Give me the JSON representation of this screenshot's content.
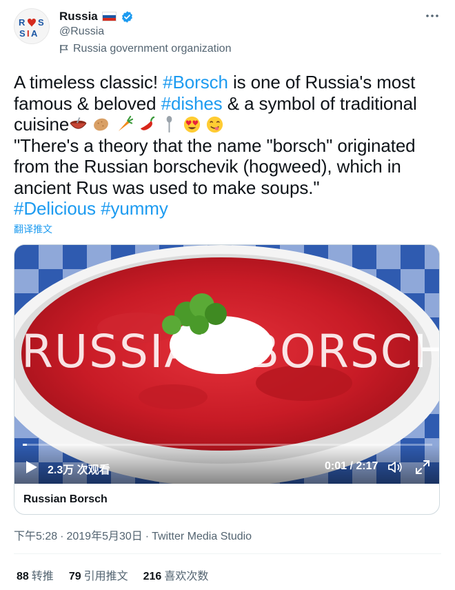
{
  "author": {
    "display_name": "Russia",
    "handle": "@Russia",
    "label": "Russia government organization",
    "avatar_text_top": "R S",
    "avatar_text_bottom": "SIA",
    "flag_colors": [
      "#ffffff",
      "#1c57a5",
      "#d52b1e"
    ],
    "verified_color": "#1d9bf0"
  },
  "tweet": {
    "line1_a": "A timeless classic! ",
    "line1_tag": "#Borsch",
    "line1_b": " is one of Russia's most",
    "line2_a": "famous & beloved ",
    "line2_tag": "#dishes",
    "line2_b": " & a symbol of traditional",
    "line3": "cuisine",
    "emojis": [
      "soup-bowl",
      "potato",
      "carrot",
      "hot-pepper",
      "spoon",
      "heart-eyes-face",
      "yum-face"
    ],
    "quote1": "\"There's a theory that the name \"borsch\" originated",
    "quote2": "from the Russian borschevik (hogweed), which in",
    "quote3": "ancient Rus was used to make soups.\"",
    "tag_a": "#Delicious",
    "tag_b": "#yummy",
    "translate": "翻译推文"
  },
  "media": {
    "overlay_title": "RUSSIAN BORSCH",
    "views": "2.3万 次观看",
    "time": "0:01 / 2:17",
    "card_title": "Russian Borsch",
    "progress": 0.007
  },
  "meta": {
    "time": "下午5:28",
    "date": "2019年5月30日",
    "source": "Twitter Media Studio"
  },
  "stats": [
    {
      "count": "88",
      "label": "转推"
    },
    {
      "count": "79",
      "label": "引用推文"
    },
    {
      "count": "216",
      "label": "喜欢次数"
    }
  ],
  "colors": {
    "accent": "#1d9bf0",
    "text": "#0f1419",
    "secondary": "#536471"
  }
}
